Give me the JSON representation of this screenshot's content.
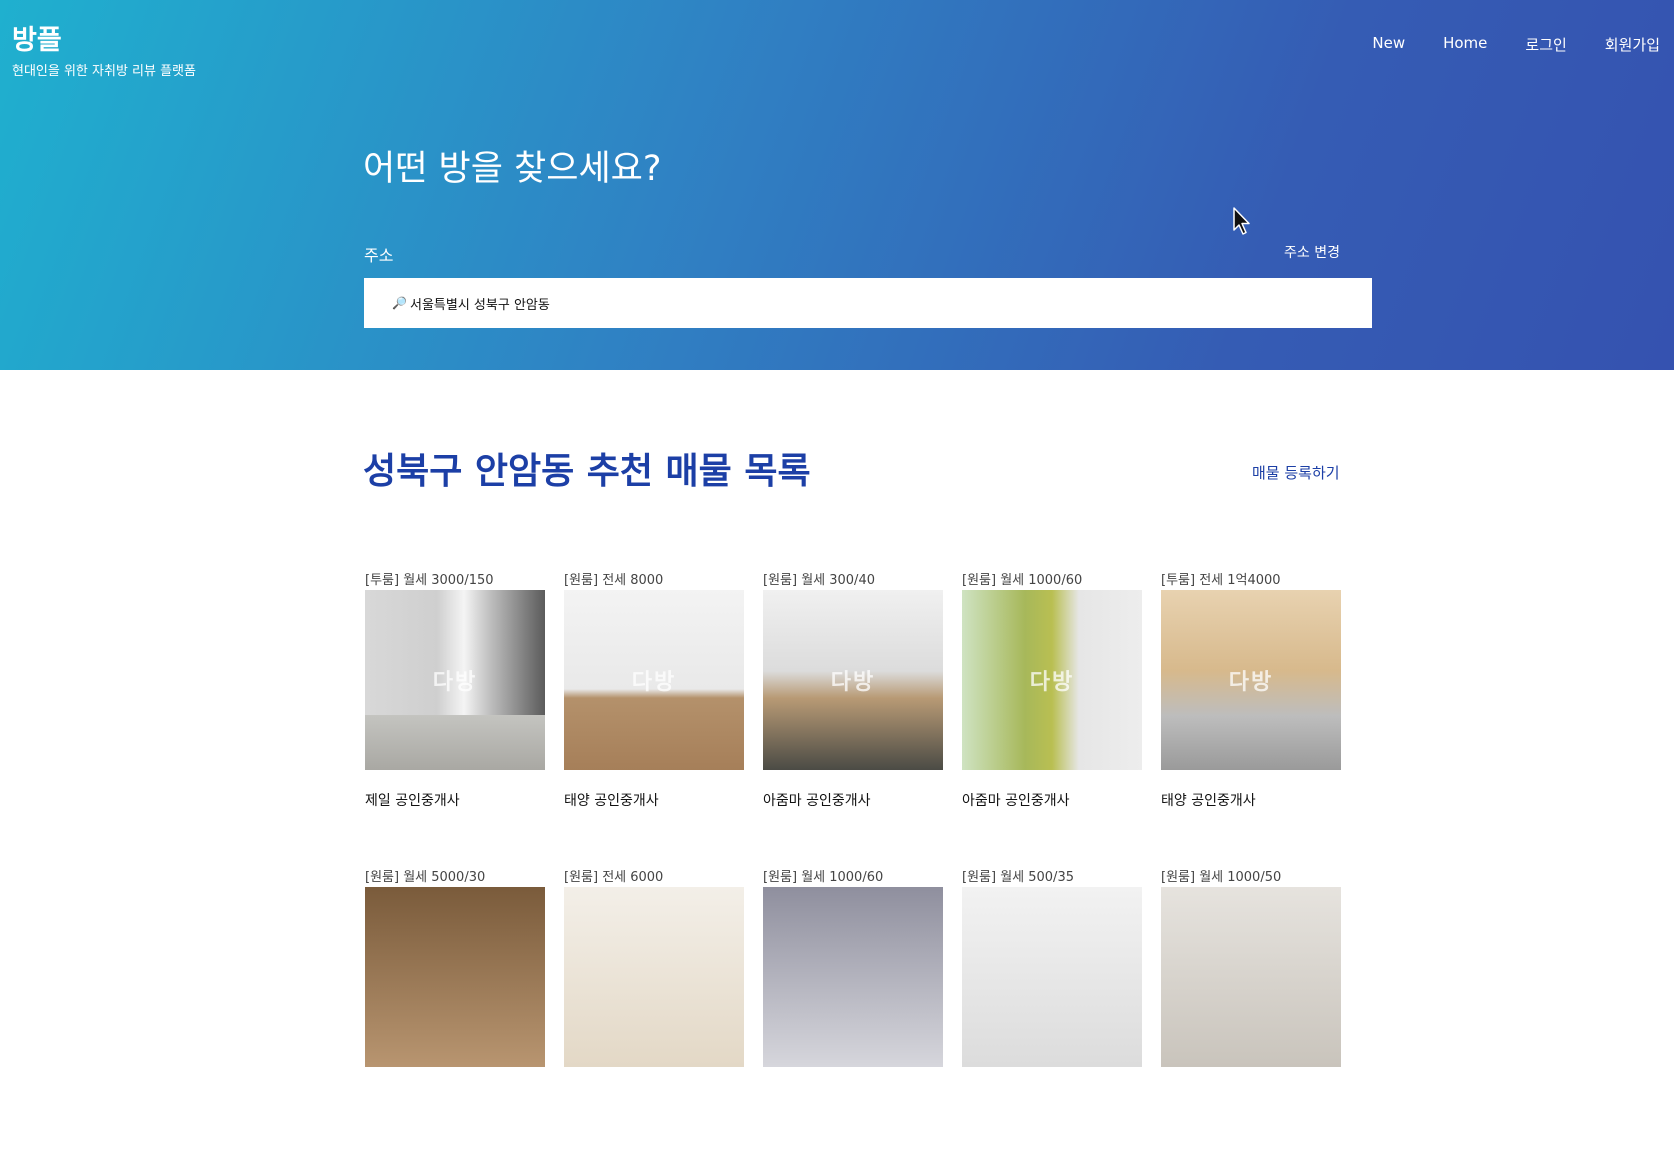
{
  "header": {
    "brand": "방플",
    "tagline": "현대인을 위한 자취방 리뷰 플랫폼",
    "nav": [
      "New",
      "Home",
      "로그인",
      "회원가입"
    ]
  },
  "hero": {
    "heading": "어떤 방을 찾으세요?",
    "address_label": "주소",
    "address_change": "주소 변경",
    "search_icon": "🔎",
    "search_value": "서울특별시 성북구 안암동"
  },
  "section": {
    "title": "성북구 안암동 추천 매물 목록",
    "register_link": "매물 등록하기"
  },
  "listings_row1": [
    {
      "label": "[투룸] 월세 3000/150",
      "agency": "제일 공인중개사",
      "watermark": "다방"
    },
    {
      "label": "[원룸] 전세 8000",
      "agency": "태양 공인중개사",
      "watermark": "다방"
    },
    {
      "label": "[원룸] 월세 300/40",
      "agency": "아줌마 공인중개사",
      "watermark": "다방"
    },
    {
      "label": "[원룸] 월세 1000/60",
      "agency": "아줌마 공인중개사",
      "watermark": "다방"
    },
    {
      "label": "[투룸] 전세 1억4000",
      "agency": "태양 공인중개사",
      "watermark": "다방"
    }
  ],
  "listings_row2": [
    {
      "label": "[원룸] 월세 5000/30"
    },
    {
      "label": "[원룸] 전세 6000"
    },
    {
      "label": "[원룸] 월세 1000/60"
    },
    {
      "label": "[원룸] 월세 500/35"
    },
    {
      "label": "[원룸] 월세 1000/50"
    }
  ],
  "colors": {
    "hero_gradient_start": "#1fb0cf",
    "hero_gradient_end": "#3552b0",
    "accent": "#1c3fa6"
  }
}
